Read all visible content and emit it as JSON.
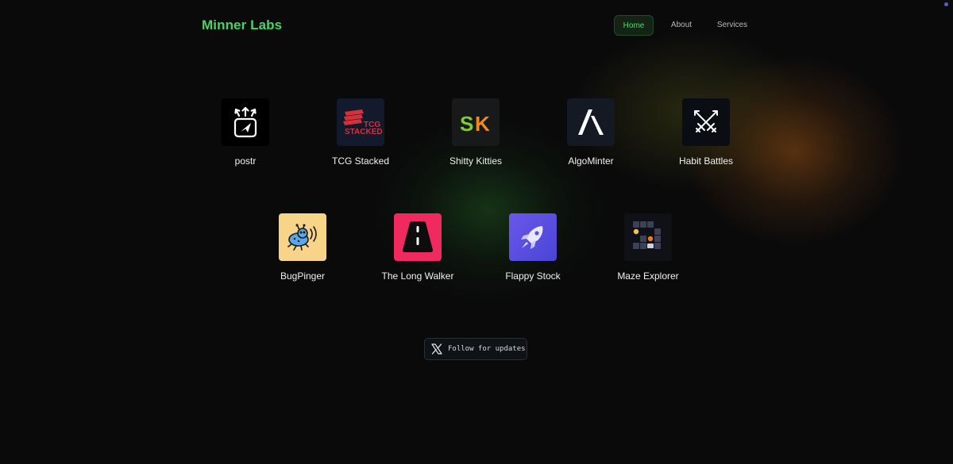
{
  "header": {
    "brand": "Minner Labs",
    "nav": [
      {
        "label": "Home",
        "active": true
      },
      {
        "label": "About",
        "active": false
      },
      {
        "label": "Services",
        "active": false
      }
    ]
  },
  "apps": [
    {
      "name": "postr",
      "icon": "send-arrows-icon",
      "bg": "#000000"
    },
    {
      "name": "TCG Stacked",
      "icon": "tcg-stacked-logo-icon",
      "bg": "#121a2c"
    },
    {
      "name": "Shitty Kitties",
      "icon": "sk-logo-icon",
      "bg": "#18191b"
    },
    {
      "name": "AlgoMinter",
      "icon": "algorand-logo-icon",
      "bg": "#131a24"
    },
    {
      "name": "Habit Battles",
      "icon": "crossed-swords-icon",
      "bg": "#0a0d12"
    },
    {
      "name": "BugPinger",
      "icon": "bug-signal-icon",
      "bg": "#f7d488"
    },
    {
      "name": "The Long Walker",
      "icon": "road-icon",
      "bg": "#f02a5e"
    },
    {
      "name": "Flappy Stock",
      "icon": "rocket-icon",
      "bg": "#5a4fe0"
    },
    {
      "name": "Maze Explorer",
      "icon": "maze-grid-icon",
      "bg": "#101117"
    }
  ],
  "tcg_logo": {
    "line1": "TCG",
    "line2": "STACKED",
    "color": "#d6303a"
  },
  "sk_logo": {
    "s": "S",
    "k": "K",
    "s_color": "#7fc93a",
    "k_color": "#ef8a22"
  },
  "follow": {
    "label": "Follow for updates",
    "icon": "x-logo-icon"
  },
  "colors": {
    "brand": "#4fcf6a",
    "background": "#0a0a0b"
  }
}
